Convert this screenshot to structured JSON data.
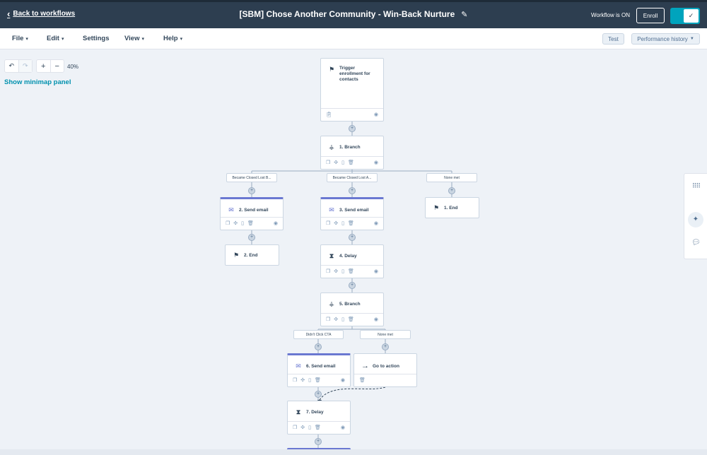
{
  "header": {
    "back_label": "Back to workflows",
    "title": "[SBM] Chose Another Community - Win-Back Nurture",
    "status": "Workflow is ON",
    "enroll_label": "Enroll"
  },
  "menu": {
    "file": "File",
    "edit": "Edit",
    "settings": "Settings",
    "view": "View",
    "help": "Help",
    "test": "Test",
    "performance": "Performance history"
  },
  "canvas": {
    "zoom": "40%",
    "minimap": "Show minimap panel"
  },
  "nodes": {
    "trigger": "Trigger enrollment for contacts",
    "branch1": "1. Branch",
    "email2": "2. Send email",
    "email3": "3. Send email",
    "end1": "1. End",
    "end2": "2. End",
    "delay4": "4. Delay",
    "branch5": "5. Branch",
    "email6": "6. Send email",
    "goto": "Go to action",
    "delay7": "7. Delay"
  },
  "branch_labels": {
    "b1_left": "Became Closed Lost B...",
    "b1_mid": "Became Closed Lost A...",
    "b1_right": "None met",
    "b5_left": "Didn't Click CTA",
    "b5_right": "None met"
  },
  "icons": {
    "flag": "⚑",
    "branch": "⚶",
    "email": "✉",
    "delay": "⧗",
    "arrow": "→"
  },
  "colors": {
    "header_bg": "#2d3e50",
    "toggle_on": "#00a4bd",
    "email_accent": "#6a78d1",
    "link": "#0091ae"
  }
}
